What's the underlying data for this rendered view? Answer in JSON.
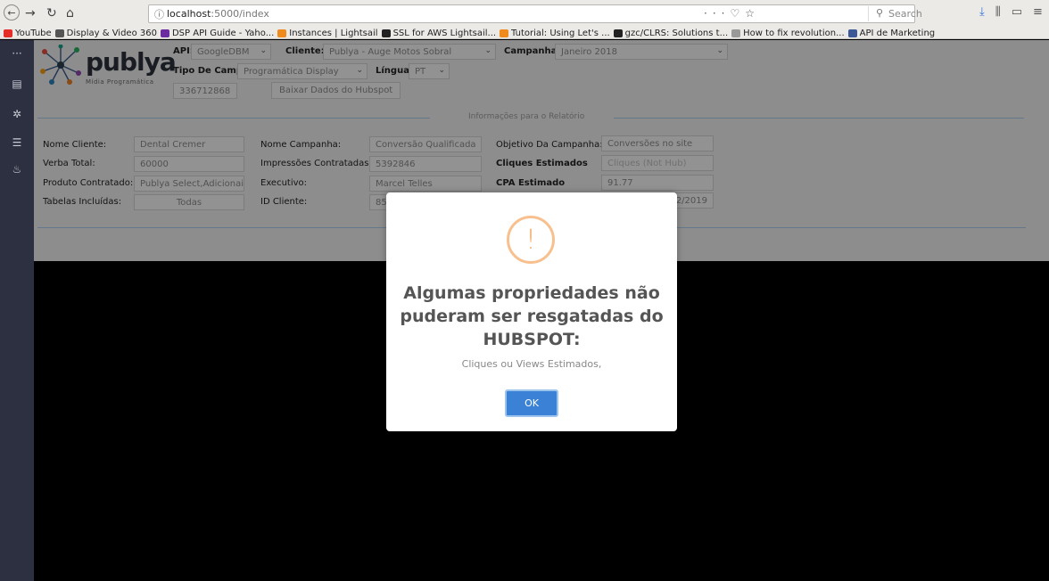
{
  "browser": {
    "url_host": "localhost",
    "url_path": ":5000/index",
    "search_placeholder": "Search",
    "bookmarks": [
      {
        "label": "YouTube",
        "color": "#e52d27"
      },
      {
        "label": "Display & Video 360",
        "color": "#555555"
      },
      {
        "label": "DSP API Guide - Yaho...",
        "color": "#6b2ca0"
      },
      {
        "label": "Instances | Lightsail",
        "color": "#f08a1c"
      },
      {
        "label": "SSL for AWS Lightsail...",
        "color": "#222222"
      },
      {
        "label": "Tutorial: Using Let's ...",
        "color": "#f08a1c"
      },
      {
        "label": "gzc/CLRS: Solutions t...",
        "color": "#222222"
      },
      {
        "label": "How to fix revolution...",
        "color": "#999999"
      },
      {
        "label": "API de Marketing",
        "color": "#3b5998"
      }
    ]
  },
  "logo": {
    "name": "publya",
    "subtitle": "Mídia Programática"
  },
  "filters": {
    "api_label": "API:",
    "api_value": "GoogleDBM",
    "cliente_label": "Cliente:",
    "cliente_value": "Publya - Auge Motos Sobral",
    "campanha_label": "Campanha:",
    "campanha_value": "Janeiro 2018",
    "tipo_label": "Tipo De Campanha:",
    "tipo_value": "Programática Display",
    "lingua_label": "Língua",
    "lingua_value": "PT",
    "id_value": "336712868",
    "baixar_label": "Baixar Dados do Hubspot"
  },
  "report": {
    "section_title": "Informações para o Relatório",
    "nome_cliente_label": "Nome Cliente:",
    "nome_cliente_value": "Dental Cremer",
    "verba_label": "Verba Total:",
    "verba_value": "60000",
    "produto_label": "Produto Contratado:",
    "produto_value": "Publya Select,Adicionais:",
    "tabelas_label": "Tabelas Incluídas:",
    "tabelas_value": "Todas",
    "nome_campanha_label": "Nome Campanha:",
    "nome_campanha_value": "Conversão Qualificada",
    "impressoes_label": "Impressões Contratadas:",
    "impressoes_value": "5392846",
    "executivo_label": "Executivo:",
    "executivo_value": "Marcel Telles",
    "id_cliente_label": "ID Cliente:",
    "id_cliente_value": "85",
    "objetivo_label": "Objetivo Da Campanha:",
    "objetivo_value": "Conversões no site",
    "cliques_label": "Cliques Estimados",
    "cliques_placeholder": "Cliques (Not Hub)",
    "cpa_label": "CPA Estimado",
    "cpa_value": "91.77",
    "date_partial": "02/2019"
  },
  "modal": {
    "icon": "!",
    "title": "Algumas propriedades não puderam ser resgatadas do HUBSPOT:",
    "text": "Cliques ou Views Estimados,",
    "ok_label": "OK"
  }
}
